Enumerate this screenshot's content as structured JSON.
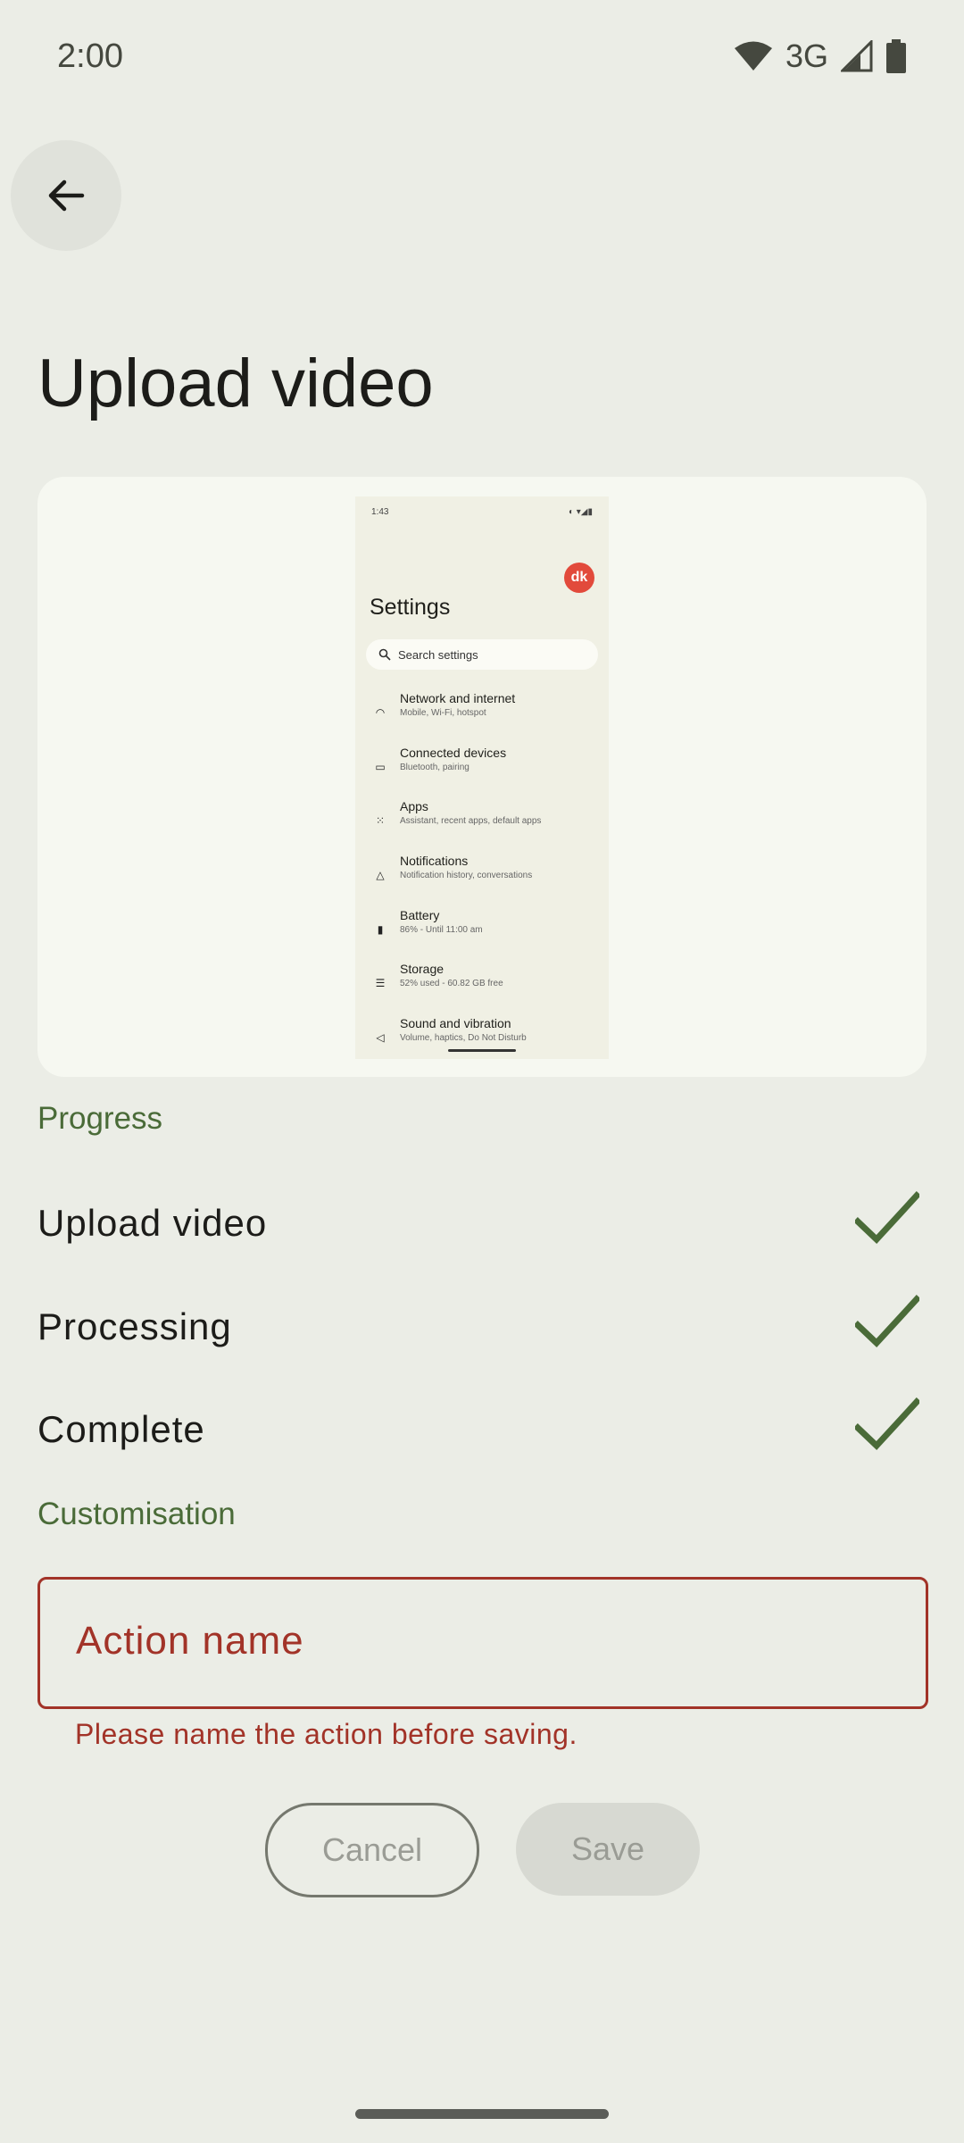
{
  "status_bar": {
    "time": "2:00",
    "network": "3G"
  },
  "page": {
    "title": "Upload video"
  },
  "preview": {
    "time": "1:43",
    "avatar_text": "dk",
    "title": "Settings",
    "search_placeholder": "Search settings",
    "items": [
      {
        "label": "Network and internet",
        "sub": "Mobile, Wi-Fi, hotspot",
        "icon": "wifi-icon"
      },
      {
        "label": "Connected devices",
        "sub": "Bluetooth, pairing",
        "icon": "devices-icon"
      },
      {
        "label": "Apps",
        "sub": "Assistant, recent apps, default apps",
        "icon": "apps-grid-icon"
      },
      {
        "label": "Notifications",
        "sub": "Notification history, conversations",
        "icon": "bell-icon"
      },
      {
        "label": "Battery",
        "sub": "86% - Until 11:00 am",
        "icon": "battery-icon"
      },
      {
        "label": "Storage",
        "sub": "52% used - 60.82 GB free",
        "icon": "storage-icon"
      },
      {
        "label": "Sound and vibration",
        "sub": "Volume, haptics, Do Not Disturb",
        "icon": "speaker-icon"
      }
    ]
  },
  "progress": {
    "heading": "Progress",
    "steps": [
      {
        "label": "Upload video",
        "done": true
      },
      {
        "label": "Processing",
        "done": true
      },
      {
        "label": "Complete",
        "done": true
      }
    ]
  },
  "customisation": {
    "heading": "Customisation",
    "action_name_placeholder": "Action name",
    "error": "Please name the action before saving."
  },
  "buttons": {
    "cancel": "Cancel",
    "save": "Save"
  },
  "colors": {
    "accent_green": "#4a6b38",
    "error_red": "#a23328",
    "background": "#ebede6"
  }
}
